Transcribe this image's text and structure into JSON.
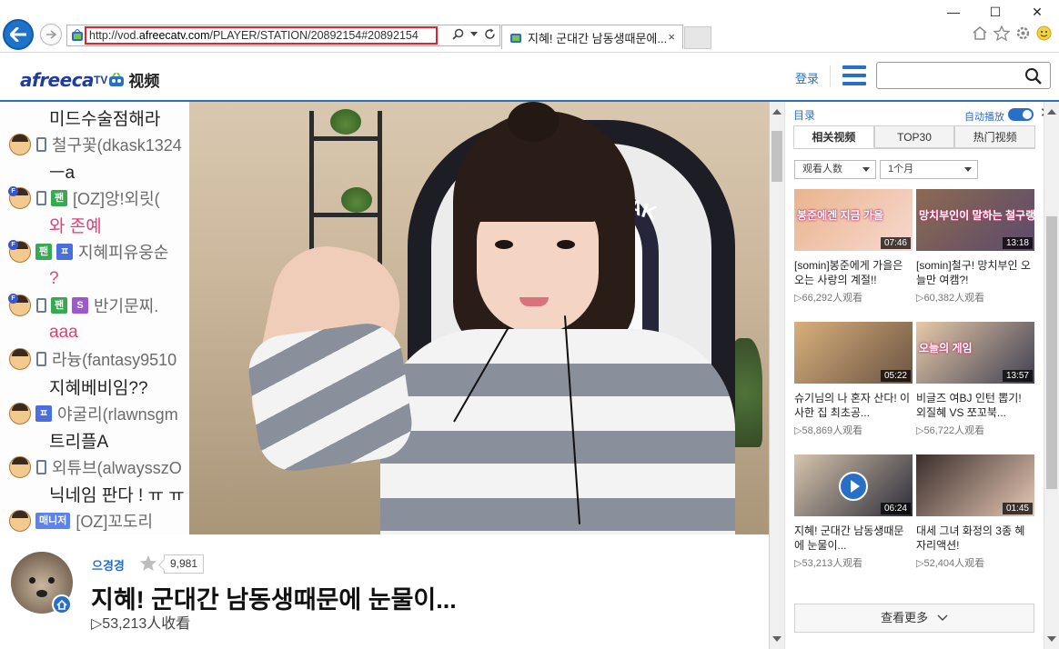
{
  "browser": {
    "url_prefix": "http://vod.",
    "url_domain": "afreecatv.com",
    "url_path": "/PLAYER/STATION/20892154#20892154",
    "tab_title": "지혜! 군대간 남동생때문에...",
    "tab_close": "×",
    "window_minimize": "—",
    "window_maximize": "☐",
    "window_close": "✕"
  },
  "header": {
    "logo_text": "afreeca",
    "logo_tv": "TV",
    "logo_suffix": "视频",
    "login": "登录",
    "search_placeholder": ""
  },
  "chat": {
    "lines": [
      {
        "type": "msg",
        "text": "미드수술점해라",
        "color": "dark"
      },
      {
        "type": "user",
        "nick": "철구꽃(dkask1324",
        "badges": [
          "phone"
        ]
      },
      {
        "type": "msg",
        "text": "ㅡa",
        "color": "dark"
      },
      {
        "type": "user",
        "nick": "[OZ]앙!외릿(",
        "badges": [
          "phone",
          "팬"
        ],
        "fan": true
      },
      {
        "type": "msg",
        "text": "와 존예",
        "color": "pink"
      },
      {
        "type": "user",
        "nick": "지혜피유웅순",
        "badges": [
          "팬",
          "ㅍ"
        ],
        "fan": true
      },
      {
        "type": "msg",
        "text": "?",
        "color": "pink"
      },
      {
        "type": "user",
        "nick": "반기문찌.",
        "badges": [
          "phone",
          "팬",
          "S"
        ],
        "fan": true
      },
      {
        "type": "msg",
        "text": "aaa",
        "color": "pink"
      },
      {
        "type": "user",
        "nick": "라늉(fantasy9510",
        "badges": [
          "phone"
        ]
      },
      {
        "type": "msg",
        "text": "지혜베비임??",
        "color": "dark"
      },
      {
        "type": "user",
        "nick": "야굴리(rlawnsgm",
        "badges": [
          "ㅍ"
        ]
      },
      {
        "type": "msg",
        "text": "트리플A",
        "color": "dark"
      },
      {
        "type": "user",
        "nick": "외튜브(alwaysszO",
        "badges": [
          "phone"
        ]
      },
      {
        "type": "msg",
        "text": "닉네임 판다 ! ㅠ ㅠ",
        "color": "dark"
      },
      {
        "type": "user",
        "nick": "[OZ]꼬도리",
        "badges": [
          "매니저"
        ]
      }
    ]
  },
  "player": {
    "chair_brand": "AK"
  },
  "video": {
    "streamer_name": "으경경",
    "favorite_count": "9,981",
    "title": "지혜! 군대간 남동생때문에 눈물이...",
    "views": "▷53,213人收看"
  },
  "panel": {
    "list_title": "目录",
    "autoplay": "自动播放",
    "close": "✕",
    "tabs": [
      {
        "label": "相关视频",
        "active": true
      },
      {
        "label": "TOP30",
        "active": false
      },
      {
        "label": "热门视频",
        "active": false
      }
    ],
    "filter_sort": "观看人数",
    "filter_period": "1个月",
    "cards": [
      {
        "duration": "07:46",
        "title": "[somin]봉준에게 가을은 오는 사랑의 계절!!",
        "views": "▷66,292人观看",
        "thumb_caption": "봉준에겐 지금 가을",
        "palette": [
          "#e9b48e",
          "#f7d9cf"
        ]
      },
      {
        "duration": "13:18",
        "title": "[somin]철구! 망치부인 오늘만 여캠?!",
        "views": "▷60,382人观看",
        "thumb_caption": "망치부인이 말하는 철구랭",
        "palette": [
          "#8c6a52",
          "#5b4a6b"
        ]
      },
      {
        "duration": "05:22",
        "title": "슈기님의 나 혼자 산다! 이사한 집 최초공...",
        "views": "▷58,869人观看",
        "thumb_caption": "",
        "palette": [
          "#d8b07c",
          "#6b5442"
        ]
      },
      {
        "duration": "13:57",
        "title": "비글즈 여BJ 인턴 뽑기! 외질혜 VS 쪼꼬북...",
        "views": "▷56,722人观看",
        "thumb_caption": "오늘의 게임",
        "palette": [
          "#e7c9a8",
          "#3f3f52"
        ]
      },
      {
        "duration": "06:24",
        "title": "지혜! 군대간 남동생때문에 눈물이...",
        "views": "▷53,213人观看",
        "thumb_caption": "",
        "palette": [
          "#d7c5ad",
          "#2b2b38"
        ]
      },
      {
        "duration": "01:45",
        "title": "대세 그녀 화정의 3종 혜자리액션!",
        "views": "▷52,404人观看",
        "thumb_caption": "",
        "palette": [
          "#3a2e2a",
          "#e8c8b6"
        ]
      }
    ],
    "more": "查看更多"
  },
  "colors": {
    "accent": "#2a6fc7",
    "url_highlight": "#e0242b",
    "chat_pink": "#e0407a"
  }
}
